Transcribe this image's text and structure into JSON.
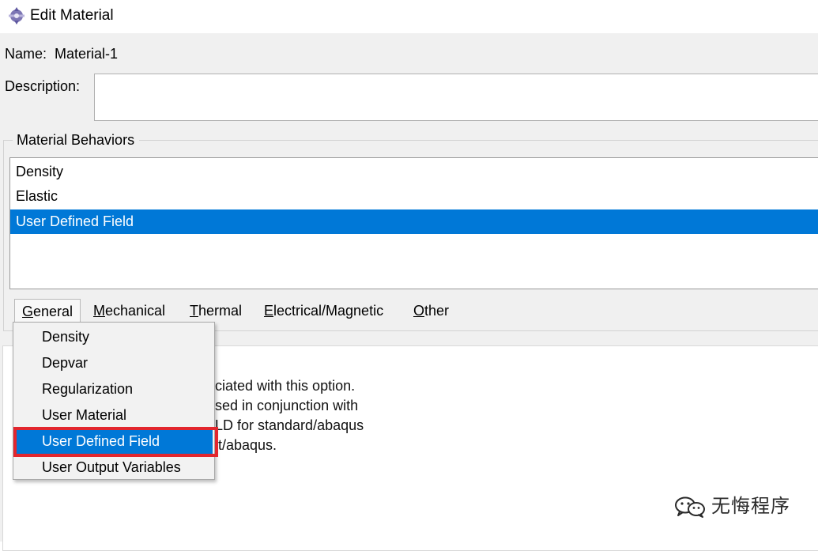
{
  "window": {
    "title": "Edit Material",
    "icon": "abaqus-app-icon"
  },
  "name_field": {
    "label": "Name:",
    "value": "Material-1"
  },
  "description_field": {
    "label": "Description:",
    "value": ""
  },
  "behaviors": {
    "legend": "Material Behaviors",
    "items": [
      {
        "label": "Density",
        "selected": false
      },
      {
        "label": "Elastic",
        "selected": false
      },
      {
        "label": "User Defined Field",
        "selected": true
      }
    ]
  },
  "menubar": {
    "items": [
      {
        "label": "General",
        "open": true
      },
      {
        "label": "Mechanical",
        "open": false
      },
      {
        "label": "Thermal",
        "open": false
      },
      {
        "label": "Electrical/Magnetic",
        "open": false
      },
      {
        "label": "Other",
        "open": false
      }
    ]
  },
  "general_menu": {
    "items": [
      {
        "label": "Density",
        "hovered": false
      },
      {
        "label": "Depvar",
        "hovered": false
      },
      {
        "label": "Regularization",
        "hovered": false
      },
      {
        "label": "User Material",
        "hovered": false
      },
      {
        "label": "User Defined Field",
        "hovered": true
      },
      {
        "label": "User Output Variables",
        "hovered": false
      }
    ]
  },
  "info_panel": {
    "text": "ciated with this option.\nsed in conjunction with\nLD for standard/abaqus\nit/abaqus."
  },
  "watermark": {
    "text": "无悔程序",
    "icon": "wechat-icon"
  },
  "colors": {
    "selection": "#0078d7",
    "annotation_red": "#e2262e",
    "window_bg": "#f0f0f0"
  }
}
